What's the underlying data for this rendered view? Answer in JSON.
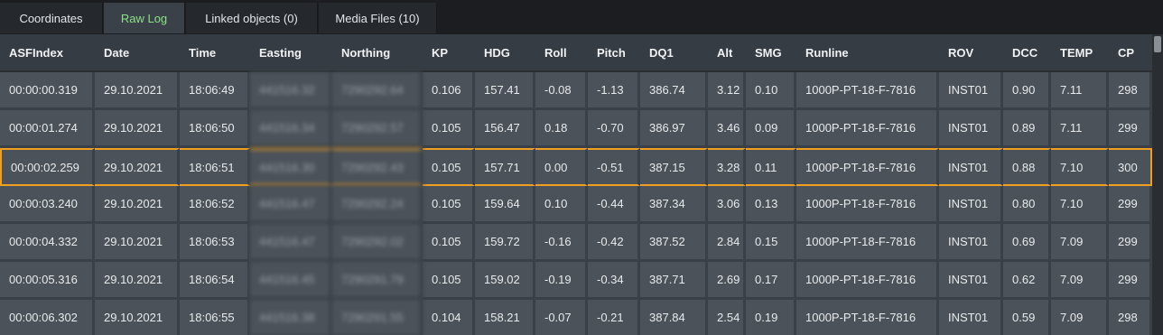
{
  "tabs": [
    {
      "label": "Coordinates",
      "active": false
    },
    {
      "label": "Raw Log",
      "active": true
    },
    {
      "label": "Linked objects (0)",
      "active": false
    },
    {
      "label": "Media Files (10)",
      "active": false
    }
  ],
  "columns": [
    "ASFIndex",
    "Date",
    "Time",
    "Easting",
    "Northing",
    "KP",
    "HDG",
    "Roll",
    "Pitch",
    "DQ1",
    "Alt",
    "SMG",
    "Runline",
    "ROV",
    "DCC",
    "TEMP",
    "CP"
  ],
  "rows": [
    [
      "00:00:00.319",
      "29.10.2021",
      "18:06:49",
      "441516.32",
      "7290292.64",
      "0.106",
      "157.41",
      "-0.08",
      "-1.13",
      "386.74",
      "3.12",
      "0.10",
      "1000P-PT-18-F-7816",
      "INST01",
      "0.90",
      "7.11",
      "298"
    ],
    [
      "00:00:01.274",
      "29.10.2021",
      "18:06:50",
      "441516.34",
      "7290292.57",
      "0.105",
      "156.47",
      "0.18",
      "-0.70",
      "386.97",
      "3.46",
      "0.09",
      "1000P-PT-18-F-7816",
      "INST01",
      "0.89",
      "7.11",
      "299"
    ],
    [
      "00:00:02.259",
      "29.10.2021",
      "18:06:51",
      "441516.30",
      "7290292.43",
      "0.105",
      "157.71",
      "0.00",
      "-0.51",
      "387.15",
      "3.28",
      "0.11",
      "1000P-PT-18-F-7816",
      "INST01",
      "0.88",
      "7.10",
      "300"
    ],
    [
      "00:00:03.240",
      "29.10.2021",
      "18:06:52",
      "441516.47",
      "7290292.24",
      "0.105",
      "159.64",
      "0.10",
      "-0.44",
      "387.34",
      "3.06",
      "0.13",
      "1000P-PT-18-F-7816",
      "INST01",
      "0.80",
      "7.10",
      "299"
    ],
    [
      "00:00:04.332",
      "29.10.2021",
      "18:06:53",
      "441516.47",
      "7290292.02",
      "0.105",
      "159.72",
      "-0.16",
      "-0.42",
      "387.52",
      "2.84",
      "0.15",
      "1000P-PT-18-F-7816",
      "INST01",
      "0.69",
      "7.09",
      "299"
    ],
    [
      "00:00:05.316",
      "29.10.2021",
      "18:06:54",
      "441516.45",
      "7290291.79",
      "0.105",
      "159.02",
      "-0.19",
      "-0.34",
      "387.71",
      "2.69",
      "0.17",
      "1000P-PT-18-F-7816",
      "INST01",
      "0.62",
      "7.09",
      "299"
    ],
    [
      "00:00:06.302",
      "29.10.2021",
      "18:06:55",
      "441516.38",
      "7290291.55",
      "0.104",
      "158.21",
      "-0.07",
      "-0.21",
      "387.84",
      "2.54",
      "0.19",
      "1000P-PT-18-F-7816",
      "INST01",
      "0.59",
      "7.09",
      "298"
    ]
  ],
  "selected_row": 2,
  "blurred_columns": [
    3,
    4
  ],
  "colors": {
    "accent_green": "#8de08a",
    "selection": "#f0a020"
  }
}
